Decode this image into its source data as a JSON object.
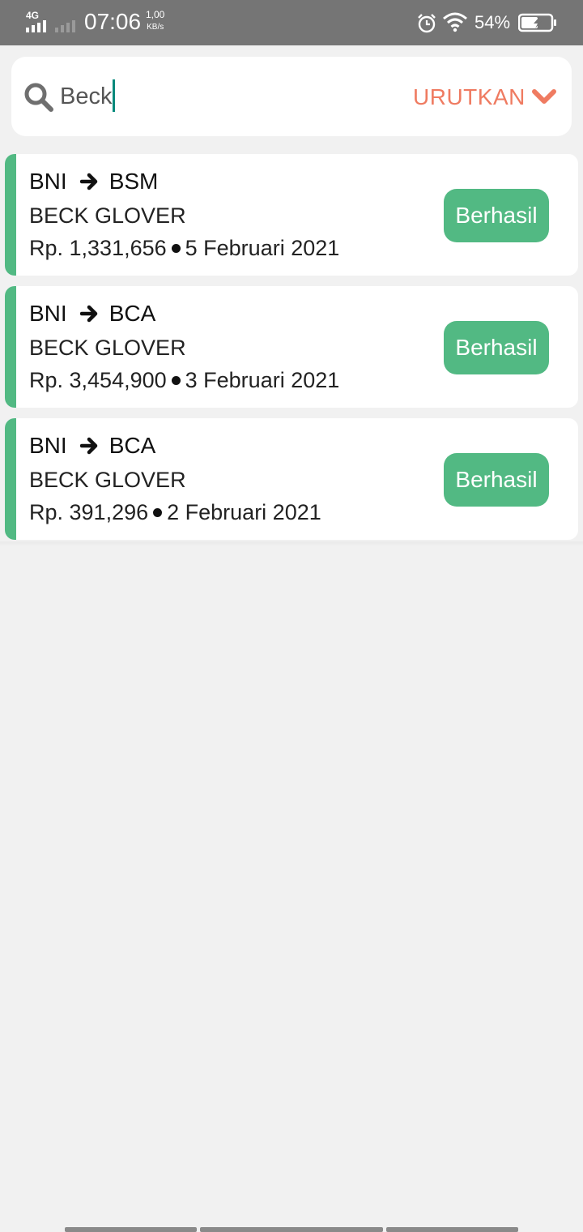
{
  "status_bar": {
    "network": "4G",
    "time": "07:06",
    "speed_value": "1,00",
    "speed_unit": "KB/s",
    "battery": "54%",
    "icons": [
      "signal-icon",
      "alarm-icon",
      "wifi-icon",
      "battery-charging-icon"
    ]
  },
  "search": {
    "value": "Beck",
    "icon": "search-icon",
    "sort_label": "URUTKAN",
    "sort_icon": "chevron-down-icon"
  },
  "transactions": [
    {
      "from": "BNI",
      "to": "BSM",
      "name": "BECK GLOVER",
      "amount": "Rp. 1,331,656",
      "date": "5 Februari 2021",
      "status": "Berhasil"
    },
    {
      "from": "BNI",
      "to": "BCA",
      "name": "BECK GLOVER",
      "amount": "Rp. 3,454,900",
      "date": "3 Februari 2021",
      "status": "Berhasil"
    },
    {
      "from": "BNI",
      "to": "BCA",
      "name": "BECK GLOVER",
      "amount": "Rp. 391,296",
      "date": "2 Februari 2021",
      "status": "Berhasil"
    }
  ],
  "colors": {
    "accent_green": "#52b983",
    "sort_orange": "#ef7b61",
    "status_bar_bg": "#757575",
    "page_bg": "#f1f1f1",
    "caret": "#00897b"
  }
}
